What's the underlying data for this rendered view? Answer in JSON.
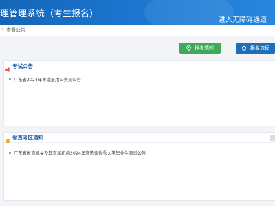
{
  "header": {
    "title": "理管理系统（考生报名）",
    "accessibility_link": "进入无障碍通道"
  },
  "breadcrumb": {
    "separator": "›",
    "current": "查看公告"
  },
  "actions": {
    "guide_label": "报考须知",
    "flow_label": "报名流程"
  },
  "exam_announcements": {
    "title": "考试公告",
    "items": [
      "广东省2024年考试录用公务员公告"
    ]
  },
  "regional_notices": {
    "title": "省直考区通知",
    "items": [
      "广东省省直机关及其直属机构2024年度选调优秀大学毕业生面试公告"
    ]
  },
  "colors": {
    "header_blue": "#1d78d2",
    "guide_green": "#3ea95a",
    "flow_blue": "#1f6fb8",
    "section_title": "#1a5fa8",
    "announce_icon": "#e14b3b",
    "bell_icon": "#f0a51c"
  }
}
